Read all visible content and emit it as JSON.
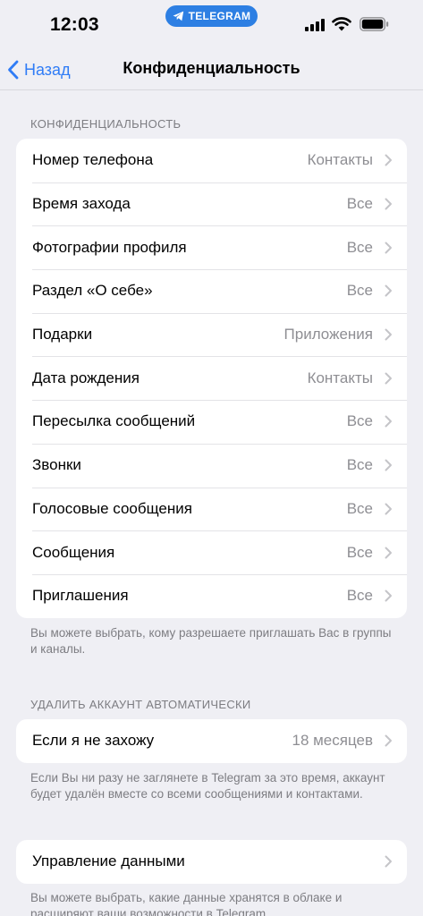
{
  "status_bar": {
    "time": "12:03",
    "app_pill": "TELEGRAM"
  },
  "nav": {
    "back_label": "Назад",
    "title": "Конфиденциальность"
  },
  "privacy": {
    "header": "КОНФИДЕНЦИАЛЬНОСТЬ",
    "items": [
      {
        "label": "Номер телефона",
        "value": "Контакты"
      },
      {
        "label": "Время захода",
        "value": "Все"
      },
      {
        "label": "Фотографии профиля",
        "value": "Все"
      },
      {
        "label": "Раздел «О себе»",
        "value": "Все"
      },
      {
        "label": "Подарки",
        "value": "Приложения"
      },
      {
        "label": "Дата рождения",
        "value": "Контакты"
      },
      {
        "label": "Пересылка сообщений",
        "value": "Все"
      },
      {
        "label": "Звонки",
        "value": "Все"
      },
      {
        "label": "Голосовые сообщения",
        "value": "Все"
      },
      {
        "label": "Сообщения",
        "value": "Все"
      },
      {
        "label": "Приглашения",
        "value": "Все"
      }
    ],
    "footer": "Вы можете выбрать, кому разрешаете приглашать Вас в группы и каналы."
  },
  "auto_delete": {
    "header": "УДАЛИТЬ АККАУНТ АВТОМАТИЧЕСКИ",
    "item": {
      "label": "Если я не захожу",
      "value": "18 месяцев"
    },
    "footer": "Если Вы ни разу не заглянете в Telegram за это время, аккаунт будет удалён вместе со всеми сообщениями и контактами."
  },
  "data": {
    "item": {
      "label": "Управление данными"
    },
    "footer": "Вы можете выбрать, какие данные хранятся в облаке и расширяют ваши возможности в Telegram."
  },
  "colors": {
    "accent": "#2f7cf6",
    "background": "#efeff4",
    "secondary_text": "#8e8e93"
  }
}
